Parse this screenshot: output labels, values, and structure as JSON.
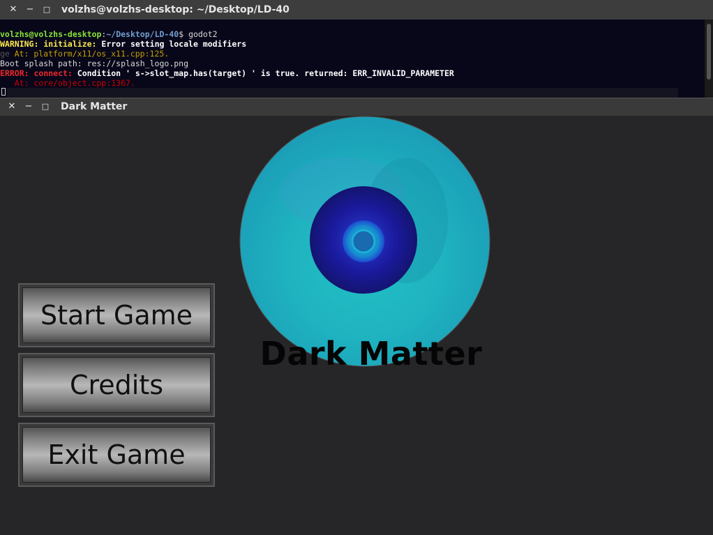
{
  "terminal": {
    "title": "volzhs@volzhs-desktop: ~/Desktop/LD-40",
    "controls": {
      "close": "✕",
      "minimize": "−",
      "maximize": "□"
    },
    "prompt_user": "volzhs@volzhs-desktop",
    "prompt_sep": ":",
    "prompt_path": "~/Desktop/LD-40",
    "prompt_symbol": "$",
    "command": " godot2",
    "warning_label": "WARNING:",
    "warning_func": " initialize:",
    "warning_msg": " Error setting locale modifiers",
    "ghost_prefix": "ge",
    "warning_at": "   At: platform/x11/os_x11.cpp:125.",
    "boot_line": "Boot splash path: res://splash_logo.png",
    "error_label": "ERROR:",
    "error_func": " connect:",
    "error_msg": " Condition ' s->slot_map.has(target) ' is true. returned: ERR_INVALID_PARAMETER",
    "error_at": "   At: core/object.cpp:1367."
  },
  "game_window": {
    "title": "Dark Matter",
    "controls": {
      "close": "✕",
      "minimize": "−",
      "maximize": "□"
    }
  },
  "logo": {
    "title": "Dark Matter",
    "colors": {
      "outer": "#1b9fb8",
      "mid": "#22c0c4",
      "inner": "#1a1a9e",
      "core": "#1aa0c8"
    }
  },
  "menu": {
    "start_label": "Start Game",
    "credits_label": "Credits",
    "exit_label": "Exit Game"
  }
}
